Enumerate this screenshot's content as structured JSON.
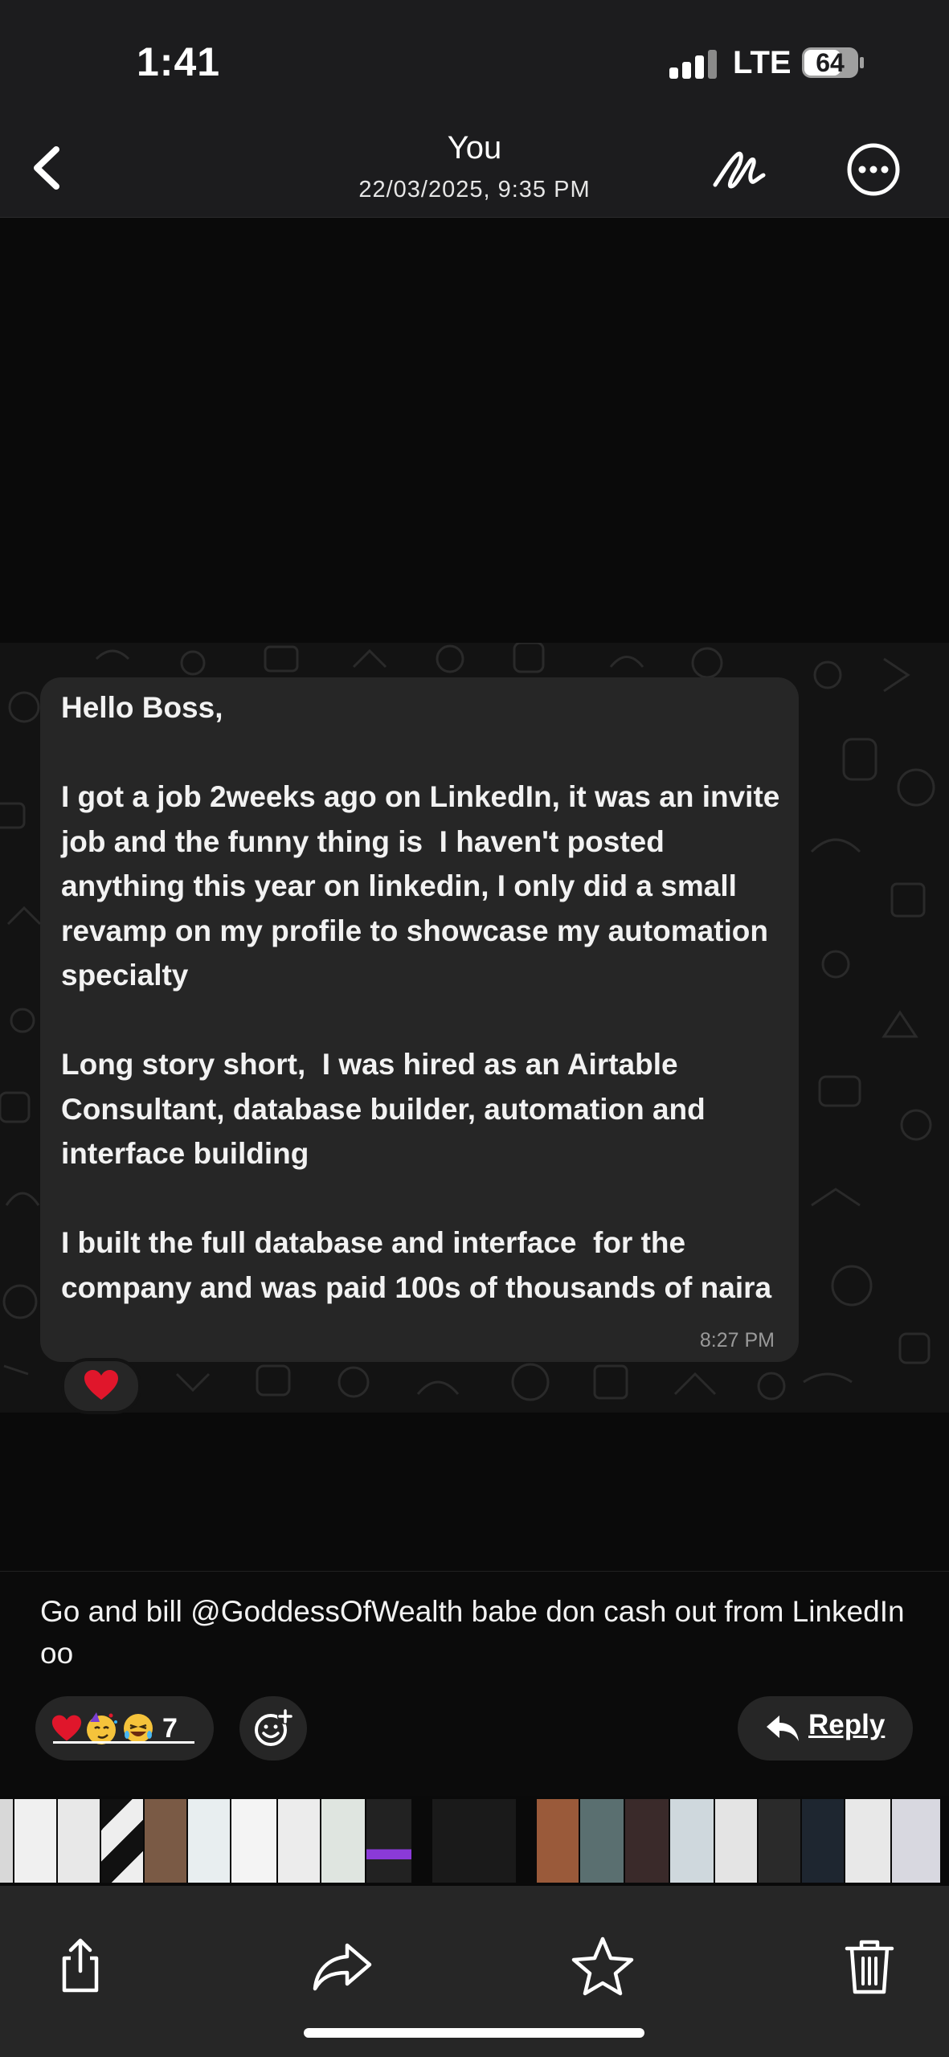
{
  "status_bar": {
    "time": "1:41",
    "network": "LTE",
    "battery": "64"
  },
  "nav": {
    "title": "You",
    "subtitle": "22/03/2025, 9:35 PM",
    "draw_icon": "markup-signature-icon",
    "more_icon": "ellipsis-circle-icon",
    "back_icon": "chevron-left-icon"
  },
  "message": {
    "text": "Hello Boss,\n\nI got a job 2weeks ago on LinkedIn, it was an invite job and the funny thing is  I haven't posted anything this year on linkedin, I only did a small revamp on my profile to showcase my automation specialty\n\nLong story short,  I was hired as an Airtable Consultant, database builder, automation and interface building\n\nI built the full database and interface  for the company and was paid 100s of thousands of naira",
    "time": "8:27 PM",
    "reaction": "heart-icon"
  },
  "reply": {
    "text": "Go and bill @GoddessOfWealth  babe don cash out from LinkedIn oo",
    "reactions": [
      "heart",
      "partying-face",
      "laughing-face"
    ],
    "reaction_count": "7",
    "reply_label": "Reply"
  },
  "toolbar": {
    "icons": [
      "share-icon",
      "forward-icon",
      "star-icon",
      "trash-icon"
    ]
  },
  "colors": {
    "background": "#0a0a0a",
    "bubble": "#262626",
    "bar": "#1c1c1e",
    "heart": "#e0162b"
  }
}
